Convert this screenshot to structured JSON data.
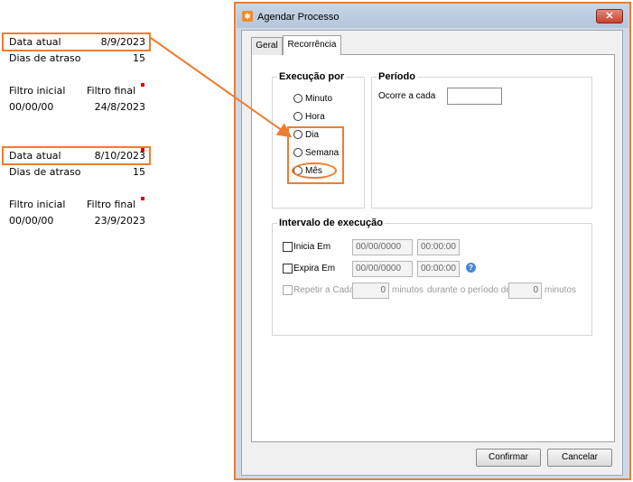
{
  "annotations": {
    "block1": {
      "data_atual_label": "Data atual",
      "data_atual_value": "8/9/2023",
      "dias_label": "Dias de atraso",
      "dias_value": "15",
      "filtro_inicial_label": "Filtro inicial",
      "filtro_final_label": "Filtro final",
      "filtro_inicial_value": "00/00/00",
      "filtro_final_value": "24/8/2023"
    },
    "block2": {
      "data_atual_label": "Data atual",
      "data_atual_value": "8/10/2023",
      "dias_label": "Dias de atraso",
      "dias_value": "15",
      "filtro_inicial_label": "Filtro inicial",
      "filtro_final_label": "Filtro final",
      "filtro_inicial_value": "00/00/00",
      "filtro_final_value": "23/9/2023"
    },
    "highlight_color": "#ed7d31"
  },
  "dialog": {
    "title": "Agendar Processo",
    "close_label": "✕",
    "tabs": [
      {
        "label": "Geral"
      },
      {
        "label": "Recorrência"
      }
    ],
    "execucao": {
      "title": "Execução por",
      "options": [
        {
          "label": "Minuto"
        },
        {
          "label": "Hora"
        },
        {
          "label": "Dia"
        },
        {
          "label": "Semana"
        },
        {
          "label": "Mês"
        }
      ]
    },
    "periodo": {
      "title": "Período",
      "ocorre_label": "Ocorre a cada",
      "ocorre_value": ""
    },
    "intervalo": {
      "title": "Intervalo de execução",
      "inicia_label": "Inicia Em",
      "inicia_date": "00/00/0000",
      "inicia_time": "00:00:00",
      "expira_label": "Expira Em",
      "expira_date": "00/00/0000",
      "expira_time": "00:00:00",
      "repetir_label": "Repetir a Cada",
      "repetir_value": "0",
      "minutos_label": "minutos",
      "durante_label": "durante o período de",
      "periodo_value": "0",
      "minutos2_label": "minutos"
    },
    "buttons": {
      "confirmar": "Confirmar",
      "cancelar": "Cancelar"
    }
  }
}
